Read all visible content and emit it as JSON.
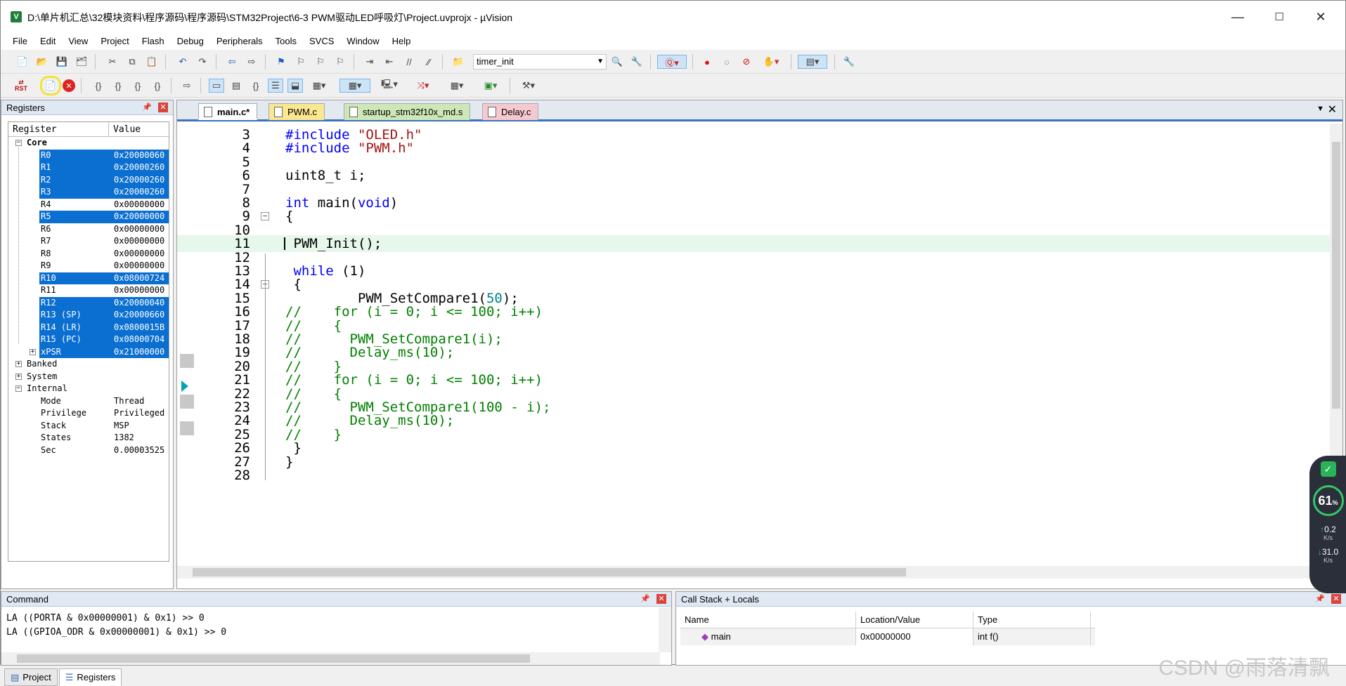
{
  "window": {
    "title": "D:\\单片机汇总\\32模块资料\\程序源码\\程序源码\\STM32Project\\6-3 PWM驱动LED呼吸灯\\Project.uvprojx - µVision",
    "app_icon": "V",
    "min": "—",
    "max": "☐",
    "close": "✕"
  },
  "menu": [
    "File",
    "Edit",
    "View",
    "Project",
    "Flash",
    "Debug",
    "Peripherals",
    "Tools",
    "SVCS",
    "Window",
    "Help"
  ],
  "toolbar1": {
    "function_dropdown": "timer_init"
  },
  "toolbar2": {
    "rst_label": "RST"
  },
  "registers": {
    "title": "Registers",
    "col_register": "Register",
    "col_value": "Value",
    "core": "Core",
    "rows": [
      {
        "name": "R0",
        "value": "0x20000060",
        "selected": true
      },
      {
        "name": "R1",
        "value": "0x20000260",
        "selected": true
      },
      {
        "name": "R2",
        "value": "0x20000260",
        "selected": true
      },
      {
        "name": "R3",
        "value": "0x20000260",
        "selected": true
      },
      {
        "name": "R4",
        "value": "0x00000000",
        "selected": false
      },
      {
        "name": "R5",
        "value": "0x20000000",
        "selected": true
      },
      {
        "name": "R6",
        "value": "0x00000000",
        "selected": false
      },
      {
        "name": "R7",
        "value": "0x00000000",
        "selected": false
      },
      {
        "name": "R8",
        "value": "0x00000000",
        "selected": false
      },
      {
        "name": "R9",
        "value": "0x00000000",
        "selected": false
      },
      {
        "name": "R10",
        "value": "0x08000724",
        "selected": true
      },
      {
        "name": "R11",
        "value": "0x00000000",
        "selected": false
      },
      {
        "name": "R12",
        "value": "0x20000040",
        "selected": true
      },
      {
        "name": "R13 (SP)",
        "value": "0x20000660",
        "selected": true
      },
      {
        "name": "R14 (LR)",
        "value": "0x0800015B",
        "selected": true
      },
      {
        "name": "R15 (PC)",
        "value": "0x08000704",
        "selected": true
      },
      {
        "name": "xPSR",
        "value": "0x21000000",
        "selected": true
      }
    ],
    "groups": [
      "Banked",
      "System",
      "Internal"
    ],
    "internal": [
      {
        "name": "Mode",
        "value": "Thread"
      },
      {
        "name": "Privilege",
        "value": "Privileged"
      },
      {
        "name": "Stack",
        "value": "MSP"
      },
      {
        "name": "States",
        "value": "1382"
      },
      {
        "name": "Sec",
        "value": "0.00003525"
      }
    ],
    "tabs": [
      "Project",
      "Registers"
    ]
  },
  "editor": {
    "tabs": [
      "main.c*",
      "PWM.c",
      "startup_stm32f10x_md.s",
      "Delay.c"
    ],
    "dropdown": "▼",
    "close": "✕",
    "lines": [
      {
        "n": "3",
        "tokens": [
          [
            "pp",
            "#include "
          ],
          [
            "str",
            "\"OLED.h\""
          ]
        ]
      },
      {
        "n": "4",
        "tokens": [
          [
            "pp",
            "#include "
          ],
          [
            "str",
            "\"PWM.h\""
          ]
        ]
      },
      {
        "n": "5",
        "tokens": []
      },
      {
        "n": "6",
        "tokens": [
          [
            "",
            "uint8_t i;"
          ]
        ]
      },
      {
        "n": "7",
        "tokens": []
      },
      {
        "n": "8",
        "tokens": [
          [
            "kw",
            "int"
          ],
          [
            "",
            " main("
          ],
          [
            "kw",
            "void"
          ],
          [
            "",
            ")"
          ]
        ]
      },
      {
        "n": "9",
        "tokens": [
          [
            "",
            "{"
          ]
        ]
      },
      {
        "n": "10",
        "tokens": []
      },
      {
        "n": "11",
        "tokens": [
          [
            "",
            " PWM_Init();"
          ]
        ]
      },
      {
        "n": "12",
        "tokens": []
      },
      {
        "n": "13",
        "tokens": [
          [
            "",
            " "
          ],
          [
            "kw",
            "while"
          ],
          [
            "",
            " (1)"
          ]
        ]
      },
      {
        "n": "14",
        "tokens": [
          [
            "",
            " {"
          ]
        ]
      },
      {
        "n": "15",
        "tokens": [
          [
            "",
            "         PWM_SetCompare1("
          ],
          [
            "num",
            "50"
          ],
          [
            "",
            ");"
          ]
        ]
      },
      {
        "n": "16",
        "tokens": [
          [
            "cm",
            "//    for (i = 0; i <= 100; i++)"
          ]
        ]
      },
      {
        "n": "17",
        "tokens": [
          [
            "cm",
            "//    {"
          ]
        ]
      },
      {
        "n": "18",
        "tokens": [
          [
            "cm",
            "//      PWM_SetCompare1(i);"
          ]
        ]
      },
      {
        "n": "19",
        "tokens": [
          [
            "cm",
            "//      Delay_ms(10);"
          ]
        ]
      },
      {
        "n": "20",
        "tokens": [
          [
            "cm",
            "//    }"
          ]
        ]
      },
      {
        "n": "21",
        "tokens": [
          [
            "cm",
            "//    for (i = 0; i <= 100; i++)"
          ]
        ]
      },
      {
        "n": "22",
        "tokens": [
          [
            "cm",
            "//    {"
          ]
        ]
      },
      {
        "n": "23",
        "tokens": [
          [
            "cm",
            "//      PWM_SetCompare1(100 - i);"
          ]
        ]
      },
      {
        "n": "24",
        "tokens": [
          [
            "cm",
            "//      Delay_ms(10);"
          ]
        ]
      },
      {
        "n": "25",
        "tokens": [
          [
            "cm",
            "//    }"
          ]
        ]
      },
      {
        "n": "26",
        "tokens": [
          [
            "",
            " }"
          ]
        ]
      },
      {
        "n": "27",
        "tokens": [
          [
            "",
            "}"
          ]
        ]
      },
      {
        "n": "28",
        "tokens": []
      }
    ]
  },
  "command": {
    "title": "Command",
    "lines": [
      "LA ((PORTA & 0x00000001) & 0x1) >> 0",
      "LA ((GPIOA_ODR & 0x00000001) & 0x1) >> 0"
    ]
  },
  "callstack": {
    "title": "Call Stack + Locals",
    "col_name": "Name",
    "col_location": "Location/Value",
    "col_type": "Type",
    "row": {
      "name": "main",
      "location": "0x00000000",
      "type": "int f()"
    }
  },
  "overlay": {
    "percent": "61",
    "percent_unit": "%",
    "up": "0.2",
    "down": "31.0",
    "unit": "K/s"
  },
  "watermark": "CSDN @雨落清飘"
}
